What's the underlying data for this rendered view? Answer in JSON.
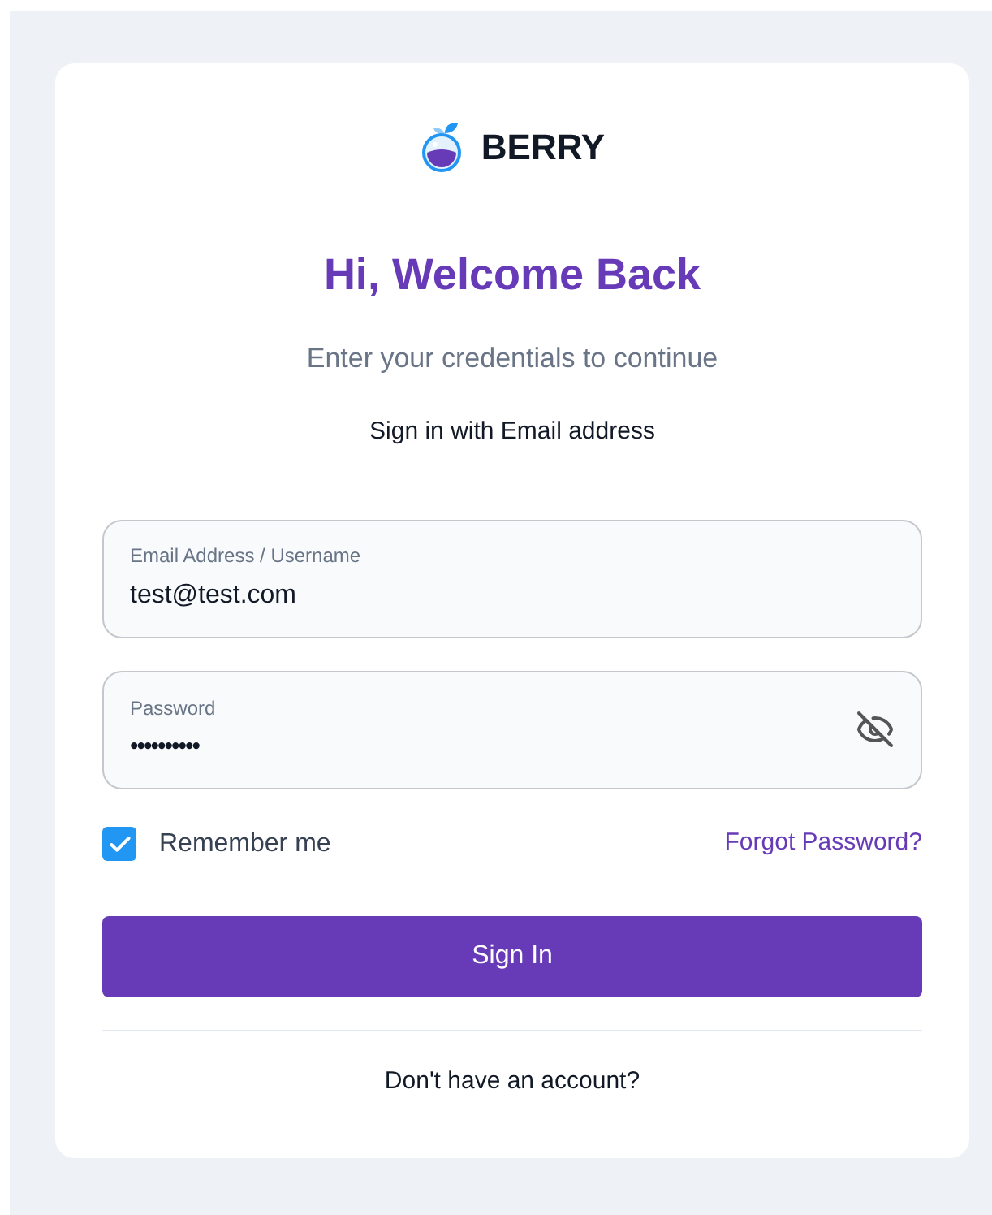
{
  "logo": {
    "name": "BERRY"
  },
  "heading": "Hi, Welcome Back",
  "subtitle": "Enter your credentials to continue",
  "method": "Sign in with Email address",
  "fields": [
    {
      "label": "Email Address / Username",
      "value": "test@test.com",
      "kind": "text"
    },
    {
      "label": "Password",
      "value": "••••••••••",
      "kind": "password"
    }
  ],
  "remember": {
    "label": "Remember me",
    "checked": true
  },
  "forgot_link": "Forgot Password?",
  "submit": "Sign In",
  "signup_link": "Don't have an account?"
}
